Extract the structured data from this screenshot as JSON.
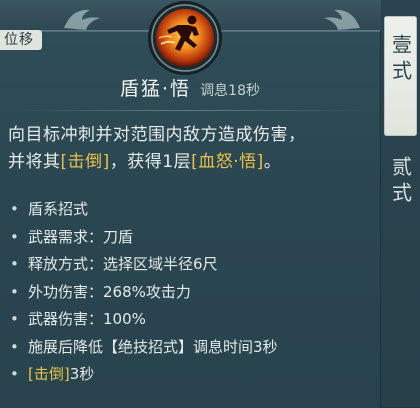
{
  "tag": {
    "label": "位移"
  },
  "skill": {
    "name": "盾猛·悟",
    "cooldown": "调息18秒"
  },
  "description": {
    "line1": "向目标冲刺并对范围内敌方造成伤害，",
    "line2_prefix": "并将其",
    "line2_hl1": "[击倒]",
    "line2_mid": "，获得1层",
    "line2_hl2": "[血怒·悟]",
    "line2_suffix": "。"
  },
  "attributes": [
    {
      "text": "盾系招式"
    },
    {
      "text": "武器需求：刀盾"
    },
    {
      "text": "释放方式：选择区域半径6尺"
    },
    {
      "text": "外功伤害：268%攻击力"
    },
    {
      "text": "武器伤害：100%"
    },
    {
      "text": "施展后降低【绝技招式】调息时间3秒"
    }
  ],
  "last_attribute": {
    "highlight": "[击倒]",
    "suffix": "3秒"
  },
  "tabs": [
    {
      "label": "壹式",
      "active": true
    },
    {
      "label": "贰式",
      "active": false
    }
  ],
  "colors": {
    "highlight": "#e9c14a",
    "panel": "#2c4853",
    "text": "#e7ece8"
  },
  "icons": {
    "skill": "running-warrior-flame-icon",
    "bullet": "bullet-dot"
  }
}
